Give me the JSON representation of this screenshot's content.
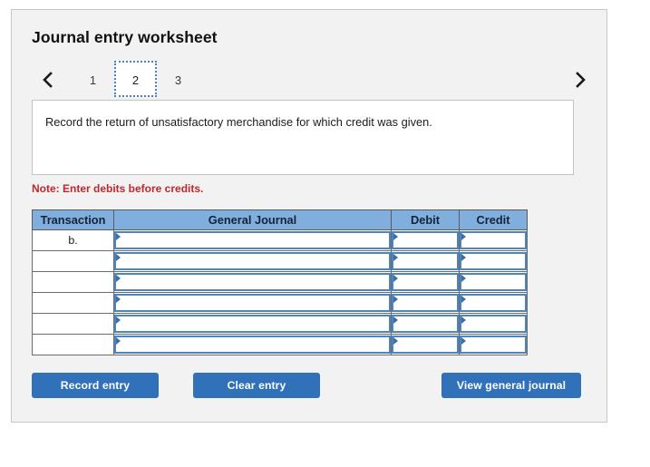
{
  "title": "Journal entry worksheet",
  "pager": {
    "prev_label": "‹",
    "next_label": "›",
    "prev_name": "chevron-left-icon",
    "next_name": "chevron-right-icon",
    "tabs": [
      {
        "label": "1",
        "active": false
      },
      {
        "label": "2",
        "active": true
      },
      {
        "label": "3",
        "active": false
      }
    ],
    "active_tab": "2"
  },
  "instruction": {
    "text": "Record the return of unsatisfactory merchandise for which credit was given."
  },
  "note": {
    "text": "Note: Enter debits before credits.",
    "color": "#c0282d"
  },
  "table": {
    "headers": [
      "Transaction",
      "General Journal",
      "Debit",
      "Credit"
    ],
    "header_bg": "#80aedd",
    "rows": [
      {
        "transaction": "b.",
        "general_journal": "",
        "debit": "",
        "credit": ""
      },
      {
        "transaction": "",
        "general_journal": "",
        "debit": "",
        "credit": ""
      },
      {
        "transaction": "",
        "general_journal": "",
        "debit": "",
        "credit": ""
      },
      {
        "transaction": "",
        "general_journal": "",
        "debit": "",
        "credit": ""
      },
      {
        "transaction": "",
        "general_journal": "",
        "debit": "",
        "credit": ""
      },
      {
        "transaction": "",
        "general_journal": "",
        "debit": "",
        "credit": ""
      }
    ]
  },
  "buttons": {
    "record_label": "Record entry",
    "clear_label": "Clear entry",
    "view_label": "View general journal",
    "color": "#3071b9"
  }
}
